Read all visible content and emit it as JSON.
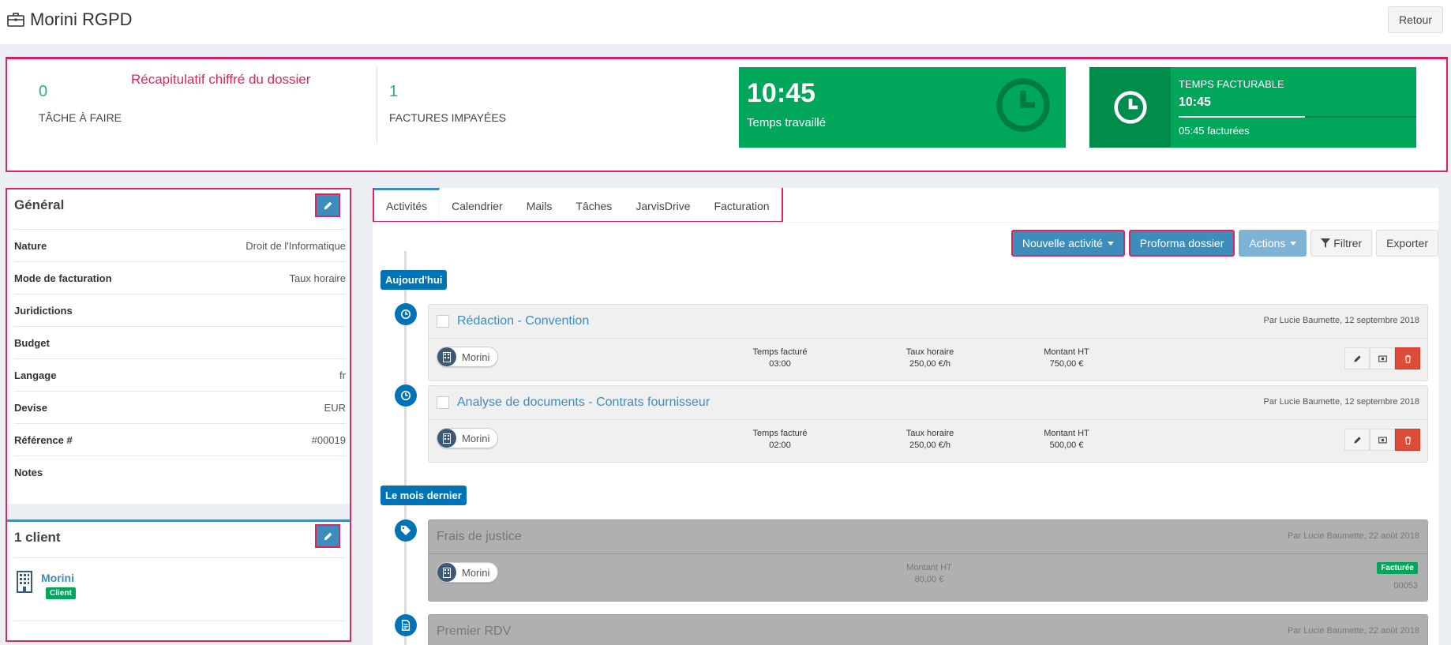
{
  "header": {
    "title": "Morini RGPD",
    "back_label": "Retour"
  },
  "summary": {
    "annotation": "Récapitulatif chiffré du dossier",
    "tasks_count": "0",
    "tasks_label": "TÂCHE À FAIRE",
    "invoices_count": "1",
    "invoices_label": "FACTURES IMPAYÉES",
    "worked_time": "10:45",
    "worked_label": "Temps travaillé",
    "billable_label": "TEMPS FACTURABLE",
    "billable_time": "10:45",
    "billed_label": "05:45 facturées",
    "billed_progress": 0.53
  },
  "general": {
    "title": "Général",
    "rows": [
      {
        "key": "Nature",
        "value": "Droit de l'Informatique"
      },
      {
        "key": "Mode de facturation",
        "value": "Taux horaire"
      },
      {
        "key": "Juridictions",
        "value": ""
      },
      {
        "key": "Budget",
        "value": ""
      },
      {
        "key": "Langage",
        "value": "fr"
      },
      {
        "key": "Devise",
        "value": "EUR"
      },
      {
        "key": "Référence #",
        "value": "#00019"
      },
      {
        "key": "Notes",
        "value": ""
      }
    ]
  },
  "clients": {
    "title": "1 client",
    "items": [
      {
        "name": "Morini",
        "tag": "Client"
      }
    ]
  },
  "tabs": [
    "Activités",
    "Calendrier",
    "Mails",
    "Tâches",
    "JarvisDrive",
    "Facturation"
  ],
  "toolbar": {
    "new_activity": "Nouvelle activité",
    "proforma": "Proforma dossier",
    "actions": "Actions",
    "filter": "Filtrer",
    "export": "Exporter"
  },
  "timeline": {
    "today_label": "Aujourd'hui",
    "last_month_label": "Le mois dernier",
    "items": [
      {
        "title": "Rédaction - Convention",
        "by": "Par Lucie Baumette, 12 septembre 2018",
        "client": "Morini",
        "time_label": "Temps facturé",
        "time": "03:00",
        "rate_label": "Taux horaire",
        "rate": "250,00 €/h",
        "amount_label": "Montant HT",
        "amount": "750,00 €"
      },
      {
        "title": "Analyse de documents - Contrats fournisseur",
        "by": "Par Lucie Baumette, 12 septembre 2018",
        "client": "Morini",
        "time_label": "Temps facturé",
        "time": "02:00",
        "rate_label": "Taux horaire",
        "rate": "250,00 €/h",
        "amount_label": "Montant HT",
        "amount": "500,00 €"
      },
      {
        "title": "Frais de justice",
        "by": "Par Lucie Baumette, 22 août 2018",
        "client": "Morini",
        "amount_label": "Montant HT",
        "amount": "80,00 €",
        "badge": "Facturée",
        "number": "00053"
      },
      {
        "title": "Premier RDV",
        "by": "Par Lucie Baumette, 22 août 2018"
      }
    ]
  },
  "colors": {
    "accent": "#3c8dbc",
    "green": "#00a65a",
    "highlight": "#e0245e",
    "danger": "#dd4b39"
  },
  "icons": [
    "briefcase-icon",
    "clock-icon",
    "pencil-icon",
    "building-icon",
    "eye-icon",
    "trash-icon",
    "tag-icon",
    "file-icon",
    "filter-icon"
  ]
}
